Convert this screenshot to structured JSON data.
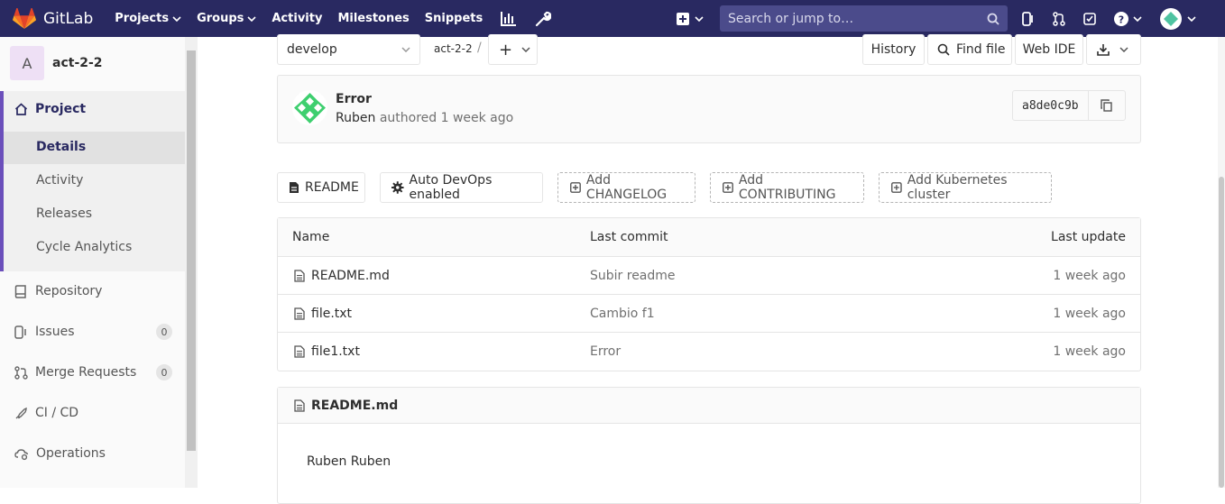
{
  "topbar": {
    "brand": "GitLab",
    "nav": [
      {
        "label": "Projects",
        "dropdown": true
      },
      {
        "label": "Groups",
        "dropdown": true
      },
      {
        "label": "Activity",
        "dropdown": false
      },
      {
        "label": "Milestones",
        "dropdown": false
      },
      {
        "label": "Snippets",
        "dropdown": false
      }
    ],
    "search_placeholder": "Search or jump to…",
    "colors": {
      "background": "#292961",
      "search": "#4b4b8b",
      "logo": "#e24329"
    }
  },
  "sidebar": {
    "project_avatar_letter": "A",
    "project_name": "act-2-2",
    "project_section": "Project",
    "project_subitems": [
      "Details",
      "Activity",
      "Releases",
      "Cycle Analytics"
    ],
    "items": [
      {
        "label": "Repository",
        "icon": "book-icon",
        "count": ""
      },
      {
        "label": "Issues",
        "icon": "issues-icon",
        "count": "0"
      },
      {
        "label": "Merge Requests",
        "icon": "merge-request-icon",
        "count": "0"
      },
      {
        "label": "CI / CD",
        "icon": "rocket-icon",
        "count": ""
      },
      {
        "label": "Operations",
        "icon": "cloud-gear-icon",
        "count": ""
      }
    ]
  },
  "toolbar": {
    "branch": "develop",
    "path": "act-2-2",
    "path_sep": "/",
    "add": "+",
    "history": "History",
    "find_file": "Find file",
    "web_ide": "Web IDE"
  },
  "commit": {
    "title": "Error",
    "author": "Ruben",
    "meta": "authored 1 week ago",
    "sha": "a8de0c9b"
  },
  "actions": {
    "readme": "README",
    "auto_devops": "Auto DevOps enabled",
    "changelog": "Add CHANGELOG",
    "contributing": "Add CONTRIBUTING",
    "kubernetes": "Add Kubernetes cluster"
  },
  "table": {
    "headers": {
      "name": "Name",
      "last_commit": "Last commit",
      "last_update": "Last update"
    },
    "rows": [
      {
        "name": "README.md",
        "commit": "Subir readme",
        "update": "1 week ago"
      },
      {
        "name": "file.txt",
        "commit": "Cambio f1",
        "update": "1 week ago"
      },
      {
        "name": "file1.txt",
        "commit": "Error",
        "update": "1 week ago"
      }
    ]
  },
  "readme": {
    "filename": "README.md",
    "content": "Ruben Ruben"
  }
}
